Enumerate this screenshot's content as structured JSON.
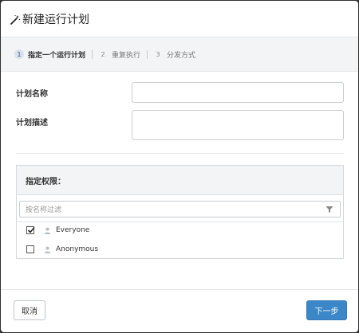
{
  "dialog": {
    "title": "新建运行计划",
    "title_icon": "magic-wand-icon"
  },
  "steps": [
    {
      "num": "1",
      "label": "指定一个运行计划",
      "active": true
    },
    {
      "num": "2",
      "label": "重复执行",
      "active": false
    },
    {
      "num": "3",
      "label": "分发方式",
      "active": false
    }
  ],
  "form": {
    "name_label": "计划名称",
    "name_value": "",
    "desc_label": "计划描述",
    "desc_value": ""
  },
  "permissions": {
    "heading": "指定权限：",
    "filter_placeholder": "按名称过滤",
    "users": [
      {
        "name": "Everyone",
        "checked": true,
        "icon": "user-icon"
      },
      {
        "name": "Anonymous",
        "checked": false,
        "icon": "user-icon"
      }
    ]
  },
  "footer": {
    "cancel_label": "取消",
    "next_label": "下一步"
  },
  "colors": {
    "primary": "#3b87c7",
    "step_bar": "#f2f4f6"
  }
}
